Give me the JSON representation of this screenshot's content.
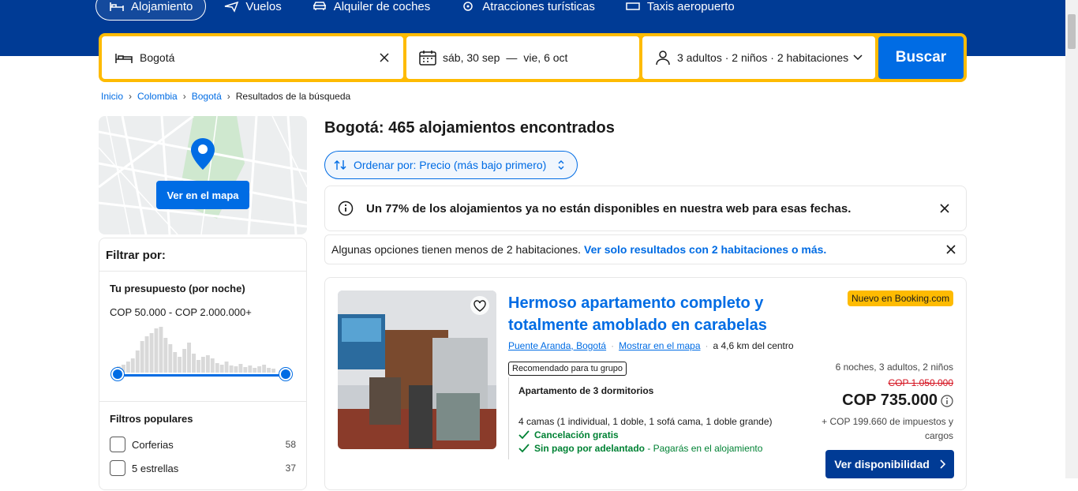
{
  "nav": {
    "items": [
      {
        "label": "Alojamiento",
        "icon": "bed-icon",
        "active": true
      },
      {
        "label": "Vuelos",
        "icon": "plane-icon",
        "active": false
      },
      {
        "label": "Alquiler de coches",
        "icon": "car-icon",
        "active": false
      },
      {
        "label": "Atracciones turísticas",
        "icon": "attractions-icon",
        "active": false
      },
      {
        "label": "Taxis aeropuerto",
        "icon": "taxi-icon",
        "active": false
      }
    ]
  },
  "search": {
    "destination": "Bogotá",
    "checkin": "sáb, 30 sep",
    "date_separator": "—",
    "checkout": "vie, 6 oct",
    "guests": "3 adultos · 2 niños · 2 habitaciones",
    "button": "Buscar"
  },
  "breadcrumb": [
    "Inicio",
    "Colombia",
    "Bogotá",
    "Resultados de la búsqueda"
  ],
  "map": {
    "button": "Ver en el mapa"
  },
  "filters": {
    "title": "Filtrar por:",
    "budget": {
      "title": "Tu presupuesto (por noche)",
      "range": "COP 50.000 - COP 2.000.000+"
    },
    "popular": {
      "title": "Filtros populares",
      "items": [
        {
          "label": "Corferias",
          "count": "58"
        },
        {
          "label": "5 estrellas",
          "count": "37"
        }
      ]
    }
  },
  "results": {
    "title": "Bogotá: 465 alojamientos encontrados",
    "sort": "Ordenar por: Precio (más bajo primero)",
    "alert_main": "Un 77% de los alojamientos ya no están disponibles en nuestra web para esas fechas.",
    "alert_rooms_text": "Algunas opciones tienen menos de 2 habitaciones.",
    "alert_rooms_link": "Ver solo resultados con 2 habitaciones o más."
  },
  "property": {
    "name": "Hermoso apartamento completo y totalmente amoblado en carabelas",
    "location": "Puente Aranda, Bogotá",
    "map_link": "Mostrar en el mapa",
    "distance": "a 4,6 km del centro",
    "recommended": "Recomendado para tu grupo",
    "unit_type": "Apartamento de 3 dormitorios",
    "beds": "4 camas (1 individual, 1 doble, 1 sofá cama, 1 doble grande)",
    "features": [
      {
        "bold": "Cancelación gratis",
        "sub": ""
      },
      {
        "bold": "Sin pago por adelantado",
        "sub": " - Pagarás en el alojamiento"
      }
    ],
    "badge": "Nuevo en Booking.com",
    "stay_info": "6 noches, 3 adultos, 2 niños",
    "old_price": "COP 1.050.000",
    "price": "COP 735.000",
    "taxes": "+ COP 199.660 de impuestos y cargos",
    "button": "Ver disponibilidad"
  },
  "colors": {
    "brand_blue": "#003b95",
    "accent_blue": "#006ce4",
    "search_yellow": "#febb02"
  }
}
